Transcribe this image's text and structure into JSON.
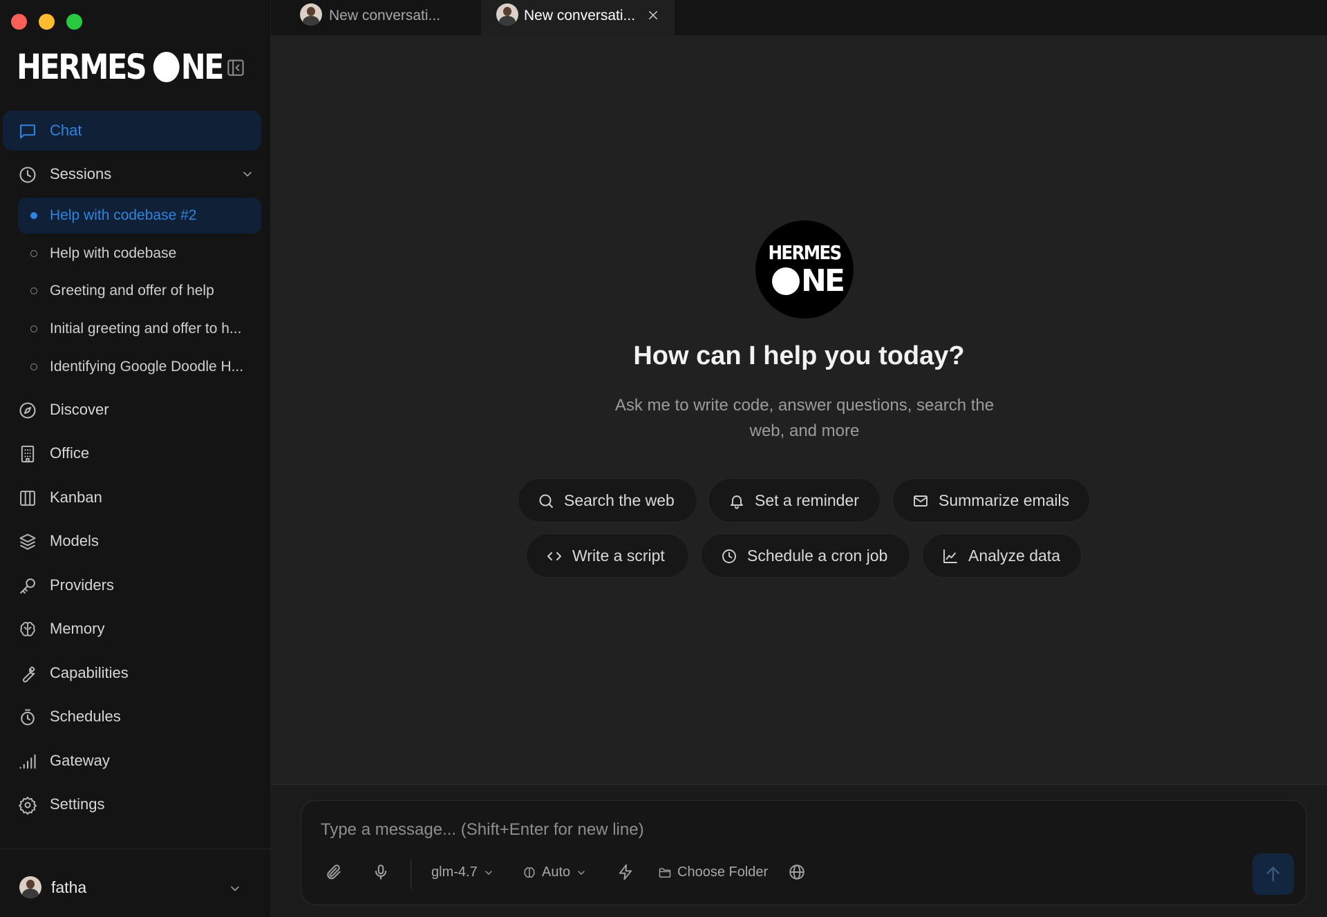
{
  "brand": {
    "name_left": "HERMES",
    "name_right": "NE"
  },
  "hero_logo": {
    "line1": "HERMES",
    "line2": "NE"
  },
  "tabs": [
    {
      "label": "New conversati..."
    },
    {
      "label": "New conversati..."
    }
  ],
  "nav": {
    "chat": "Chat",
    "sessions": "Sessions",
    "discover": "Discover",
    "office": "Office",
    "kanban": "Kanban",
    "models": "Models",
    "providers": "Providers",
    "memory": "Memory",
    "capabilities": "Capabilities",
    "schedules": "Schedules",
    "gateway": "Gateway",
    "settings": "Settings"
  },
  "sessions": [
    {
      "label": "Help with codebase #2"
    },
    {
      "label": "Help with codebase"
    },
    {
      "label": "Greeting and offer of help"
    },
    {
      "label": "Initial greeting and offer to h..."
    },
    {
      "label": "Identifying Google Doodle H..."
    }
  ],
  "user": {
    "name": "fatha"
  },
  "hero": {
    "title": "How can I help you today?",
    "subtitle": "Ask me to write code, answer questions, search the web, and more"
  },
  "suggestions": [
    {
      "label": "Search the web",
      "icon": "search-icon"
    },
    {
      "label": "Set a reminder",
      "icon": "bell-icon"
    },
    {
      "label": "Summarize emails",
      "icon": "mail-icon"
    },
    {
      "label": "Write a script",
      "icon": "code-icon"
    },
    {
      "label": "Schedule a cron job",
      "icon": "clock-icon"
    },
    {
      "label": "Analyze data",
      "icon": "chart-icon"
    }
  ],
  "composer": {
    "placeholder": "Type a message... (Shift+Enter for new line)",
    "model": "glm-4.7",
    "reasoning": "Auto",
    "folder": "Choose Folder"
  },
  "colors": {
    "accent": "#2f84e0",
    "active_bg": "#0f2037",
    "sidebar_bg": "#141414",
    "main_bg": "#212121"
  }
}
